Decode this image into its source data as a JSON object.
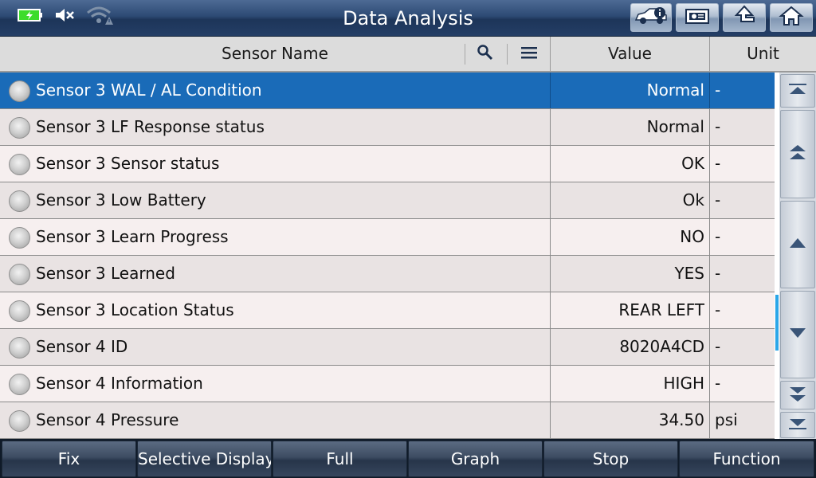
{
  "title": "Data Analysis",
  "status_icons": [
    "battery-charging-icon",
    "speaker-muted-icon",
    "wifi-warning-icon"
  ],
  "nav_buttons": [
    {
      "name": "vehicle-info-button",
      "icon": "car-info-icon"
    },
    {
      "name": "print-button",
      "icon": "printer-icon"
    },
    {
      "name": "back-button",
      "icon": "return-arrow-icon"
    },
    {
      "name": "home-button",
      "icon": "home-icon"
    }
  ],
  "columns": {
    "name": "Sensor Name",
    "value": "Value",
    "unit": "Unit"
  },
  "rows": [
    {
      "name": "Sensor 3 WAL / AL Condition",
      "value": "Normal",
      "unit": "-",
      "selected": true
    },
    {
      "name": "Sensor 3 LF Response status",
      "value": "Normal",
      "unit": "-"
    },
    {
      "name": "Sensor 3 Sensor status",
      "value": "OK",
      "unit": "-"
    },
    {
      "name": "Sensor 3 Low Battery",
      "value": "Ok",
      "unit": "-"
    },
    {
      "name": "Sensor 3 Learn Progress",
      "value": "NO",
      "unit": "-"
    },
    {
      "name": "Sensor 3 Learned",
      "value": "YES",
      "unit": "-"
    },
    {
      "name": "Sensor 3 Location Status",
      "value": "REAR LEFT",
      "unit": "-"
    },
    {
      "name": "Sensor 4 ID",
      "value": "8020A4CD",
      "unit": "-"
    },
    {
      "name": "Sensor 4 Information",
      "value": "HIGH",
      "unit": "-"
    },
    {
      "name": "Sensor 4 Pressure",
      "value": "34.50",
      "unit": "psi"
    }
  ],
  "scroll_buttons": [
    "scroll-top-icon",
    "page-up-icon",
    "scroll-up-icon",
    "scroll-down-icon",
    "page-down-icon",
    "scroll-bottom-icon"
  ],
  "function_buttons": [
    "Fix",
    "Selective Display",
    "Full",
    "Graph",
    "Stop",
    "Function"
  ],
  "colors": {
    "selected_row": "#1a6bb8",
    "scroll_thumb": "#2aa6e8",
    "battery": "#3ddc2c"
  }
}
